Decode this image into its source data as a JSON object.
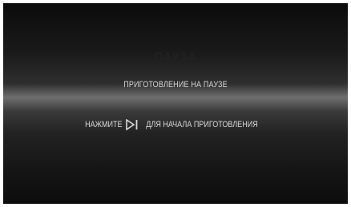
{
  "screen": {
    "ghost_title": "ПАУЗА",
    "status": "ПРИГОТОВЛЕНИЕ НА ПАУЗЕ",
    "instruction_before": "НАЖМИТЕ",
    "instruction_icon": "play-pause-icon",
    "instruction_after": "ДЛЯ НАЧАЛА ПРИГОТОВЛЕНИЯ"
  },
  "colors": {
    "text": "#d8d8d8",
    "background": "#1a1a1a"
  }
}
